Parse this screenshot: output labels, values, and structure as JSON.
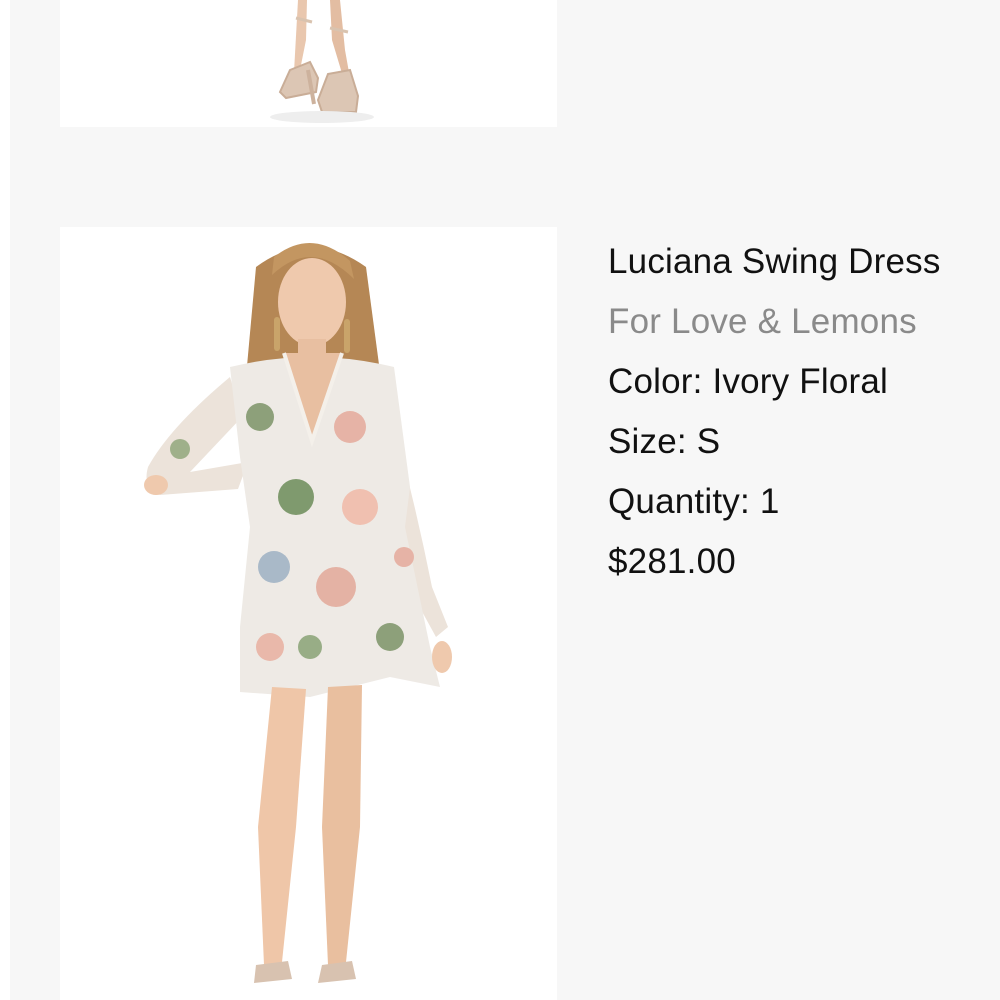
{
  "order_items": [
    {
      "image_alt": "Product photo: model wearing nude ankle-strap heels"
    },
    {
      "image_alt": "Product photo: model wearing a floral long-sleeve swing dress",
      "name": "Luciana Swing Dress",
      "brand": "For Love & Lemons",
      "color_label": "Color:",
      "color_value": "Ivory Floral",
      "size_label": "Size:",
      "size_value": "S",
      "quantity_label": "Quantity:",
      "quantity_value": "1",
      "price": "$281.00"
    }
  ],
  "colors": {
    "page_background": "#f7f7f7",
    "image_background": "#ffffff",
    "text_primary": "#111111",
    "text_brand": "#8a8a8a"
  }
}
